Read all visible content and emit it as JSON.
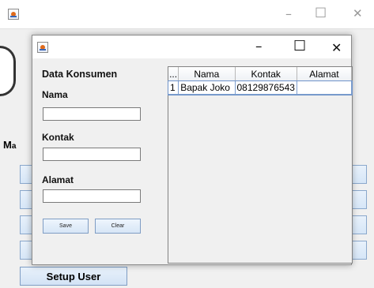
{
  "main_window": {
    "minimize": "–",
    "maximize": "☐",
    "close": "✕",
    "partial_label": "M",
    "setup_user_label": "Setup User"
  },
  "dialog": {
    "minimize": "–",
    "maximize": "☐",
    "close": "✕",
    "form_title": "Data Konsumen",
    "nama_label": "Nama",
    "nama_value": "",
    "kontak_label": "Kontak",
    "kontak_value": "",
    "alamat_label": "Alamat",
    "alamat_value": "",
    "save_label": "Save",
    "clear_label": "Clear"
  },
  "table": {
    "columns": [
      "...",
      "Nama",
      "Kontak",
      "Alamat"
    ],
    "rows": [
      [
        "1",
        "Bapak Joko",
        "08129876543",
        ""
      ]
    ]
  },
  "colors": {
    "window_bg": "#f0f0f0",
    "titlebar_bg": "#ffffff",
    "button_border": "#7f9dc4",
    "selection_border": "#6f93c9"
  }
}
